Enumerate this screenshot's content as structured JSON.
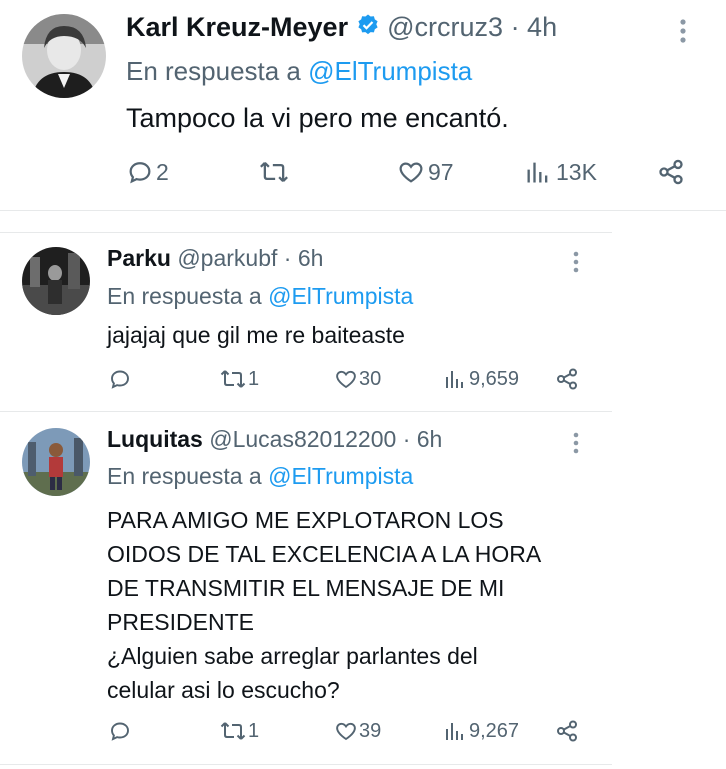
{
  "main_tweet": {
    "name": "Karl Kreuz-Meyer",
    "handle": "@crcruz3",
    "time": "· 4h",
    "reply_prefix": "En respuesta a",
    "reply_to": "@ElTrumpista",
    "text": "Tampoco la vi pero me encantó.",
    "replies": "2",
    "retweets": "",
    "likes": "97",
    "views": "13K",
    "verified": true
  },
  "replies": [
    {
      "name": "Parku",
      "handle": "@parkubf",
      "time": "· 6h",
      "reply_prefix": "En respuesta a",
      "reply_to": "@ElTrumpista",
      "text": "jajajaj que gil me re baiteaste",
      "replies": "",
      "retweets": "1",
      "likes": "30",
      "views": "9,659"
    },
    {
      "name": "Luquitas",
      "handle": "@Lucas82012200",
      "time": "· 6h",
      "reply_prefix": "En respuesta a",
      "reply_to": "@ElTrumpista",
      "text_lines": [
        "PARA AMIGO ME EXPLOTARON LOS",
        "OIDOS DE TAL EXCELENCIA A LA HORA",
        "DE TRANSMITIR EL MENSAJE DE MI",
        "PRESIDENTE",
        "¿Alguien sabe arreglar parlantes del",
        "celular asi lo escucho?"
      ],
      "replies": "",
      "retweets": "1",
      "likes": "39",
      "views": "9,267"
    }
  ],
  "colors": {
    "link": "#1d9bf0",
    "secondary": "#536471",
    "primary": "#0f1419",
    "divider": "#e7e9ea"
  },
  "icons": [
    "reply-icon",
    "retweet-icon",
    "like-icon",
    "views-icon",
    "share-icon",
    "more-icon",
    "verified-icon"
  ]
}
